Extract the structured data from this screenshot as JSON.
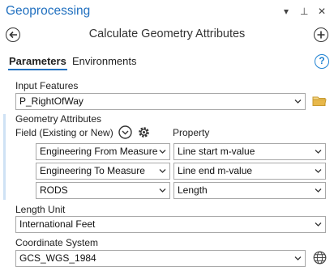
{
  "pane": {
    "title": "Geoprocessing",
    "tool_title": "Calculate Geometry Attributes"
  },
  "tabs": [
    {
      "label": "Parameters"
    },
    {
      "label": "Environments"
    }
  ],
  "help": {
    "glyph": "?"
  },
  "input_features": {
    "label": "Input Features",
    "value": "P_RightOfWay"
  },
  "geometry_attributes": {
    "label": "Geometry Attributes",
    "field_header": "Field (Existing or New)",
    "property_header": "Property",
    "rows": [
      {
        "field": "Engineering From Measure",
        "property": "Line start m-value"
      },
      {
        "field": "Engineering To Measure",
        "property": "Line end m-value"
      },
      {
        "field": "RODS",
        "property": "Length"
      }
    ]
  },
  "length_unit": {
    "label": "Length Unit",
    "value": "International Feet"
  },
  "coordinate_system": {
    "label": "Coordinate System",
    "value": "GCS_WGS_1984"
  },
  "icons": {
    "pane_controls": [
      "chevron-down-icon",
      "pin-icon",
      "close-icon"
    ],
    "back": "back-arrow-icon",
    "add": "add-icon",
    "folder": "folder-icon",
    "globe": "globe-icon"
  },
  "colors": {
    "accent_blue": "#1f6fbf",
    "folder_yellow": "#e8b84a"
  }
}
